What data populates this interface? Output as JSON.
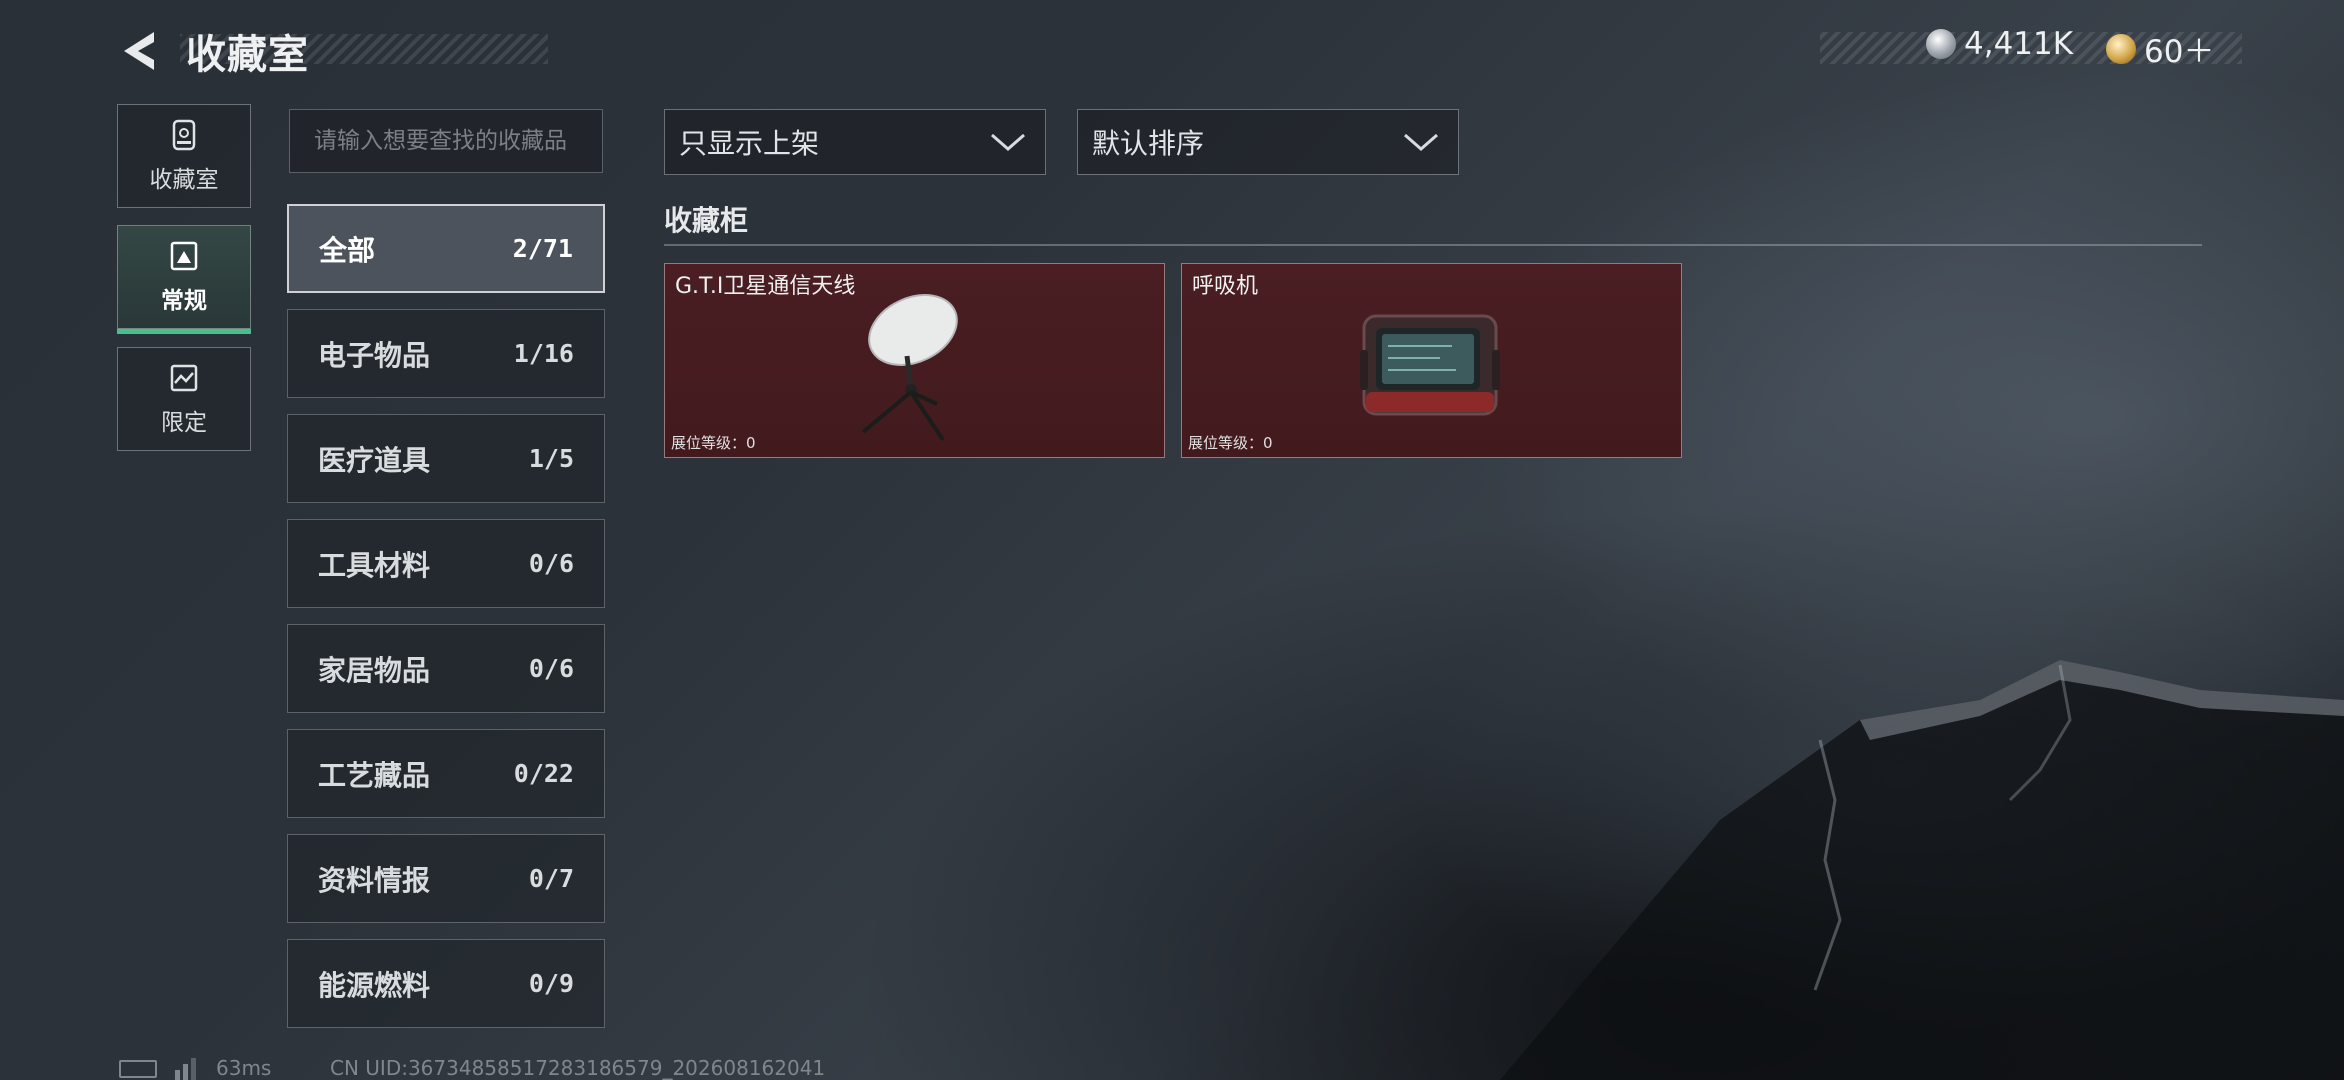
{
  "header": {
    "title": "收藏室",
    "currencies": [
      {
        "icon": "silver-coin-icon",
        "amount": "4,411K"
      },
      {
        "icon": "gold-coin-icon",
        "amount": "60＋"
      }
    ]
  },
  "nav": {
    "items": [
      {
        "label": "收藏室",
        "icon": "collection-room-icon",
        "active": false
      },
      {
        "label": "常规",
        "icon": "regular-icon",
        "active": true
      },
      {
        "label": "限定",
        "icon": "limited-icon",
        "active": false
      }
    ]
  },
  "search": {
    "placeholder": "请输入想要查找的收藏品"
  },
  "categories": [
    {
      "name": "全部",
      "count": "2/71",
      "active": true
    },
    {
      "name": "电子物品",
      "count": "1/16"
    },
    {
      "name": "医疗道具",
      "count": "1/5"
    },
    {
      "name": "工具材料",
      "count": "0/6"
    },
    {
      "name": "家居物品",
      "count": "0/6"
    },
    {
      "name": "工艺藏品",
      "count": "0/22"
    },
    {
      "name": "资料情报",
      "count": "0/7"
    },
    {
      "name": "能源燃料",
      "count": "0/9"
    }
  ],
  "filters": {
    "display_filter": "只显示上架",
    "sort": "默认排序"
  },
  "section_title": "收藏柜",
  "cards": [
    {
      "name": "G.T.I卫星通信天线",
      "level_label": "展位等级：0",
      "icon": "satellite-dish-icon"
    },
    {
      "name": "呼吸机",
      "level_label": "展位等级：0",
      "icon": "ventilator-icon"
    }
  ],
  "footer": {
    "ping": "63ms",
    "uid": "CN UID:3673485851728318657​9_202608162041"
  },
  "colors": {
    "accent": "#48c08c",
    "card_bg": "#4a1e22"
  }
}
